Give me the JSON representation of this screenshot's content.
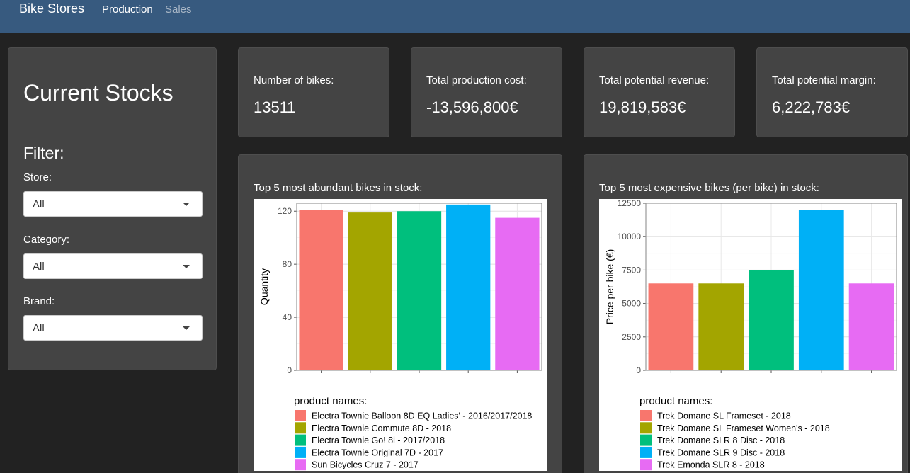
{
  "nav": {
    "brand": "Bike Stores",
    "tabs": [
      {
        "label": "Production"
      },
      {
        "label": "Sales"
      }
    ]
  },
  "sidebar": {
    "title": "Current Stocks",
    "filter_title": "Filter:",
    "filters": [
      {
        "label": "Store:",
        "value": "All"
      },
      {
        "label": "Category:",
        "value": "All"
      },
      {
        "label": "Brand:",
        "value": "All"
      }
    ]
  },
  "kpis": [
    {
      "label": "Number of bikes:",
      "value": "13511"
    },
    {
      "label": "Total production cost:",
      "value": "-13,596,800€"
    },
    {
      "label": "Total potential revenue:",
      "value": "19,819,583€"
    },
    {
      "label": "Total potential margin:",
      "value": "6,222,783€"
    }
  ],
  "colors": {
    "navbar": "#375a7f",
    "panel": "#444444",
    "background": "#222222"
  },
  "chart_data": [
    {
      "type": "bar",
      "title": "Top 5 most abundant bikes in stock:",
      "ylabel": "Quantity",
      "xlabel": "",
      "ylim": [
        0,
        126
      ],
      "yticks": [
        0,
        40,
        80,
        120
      ],
      "legend_title": "product names:",
      "categories": [
        "Electra Townie Balloon 8D EQ Ladies' - 2016/2017/2018",
        "Electra Townie Commute 8D - 2018",
        "Electra Townie Go! 8i - 2017/2018",
        "Electra Townie Original 7D - 2017",
        "Sun Bicycles Cruz 7 - 2017"
      ],
      "values": [
        121,
        119,
        120,
        125,
        115
      ],
      "colors": [
        "#F8766D",
        "#A3A500",
        "#00BF7D",
        "#00B0F6",
        "#E76BF3"
      ],
      "grid": true,
      "legend_position": "bottom"
    },
    {
      "type": "bar",
      "title": "Top 5 most expensive bikes (per bike) in stock:",
      "ylabel": "Price per bike (€)",
      "xlabel": "",
      "ylim": [
        0,
        12500
      ],
      "yticks": [
        0,
        2500,
        5000,
        7500,
        10000,
        12500
      ],
      "legend_title": "product names:",
      "categories": [
        "Trek Domane SL Frameset - 2018",
        "Trek Domane SL Frameset Women's - 2018",
        "Trek Domane SLR 8 Disc - 2018",
        "Trek Domane SLR 9 Disc - 2018",
        "Trek Emonda SLR 8 - 2018"
      ],
      "values": [
        6500,
        6500,
        7500,
        12000,
        6500
      ],
      "colors": [
        "#F8766D",
        "#A3A500",
        "#00BF7D",
        "#00B0F6",
        "#E76BF3"
      ],
      "grid": true,
      "legend_position": "bottom"
    }
  ]
}
